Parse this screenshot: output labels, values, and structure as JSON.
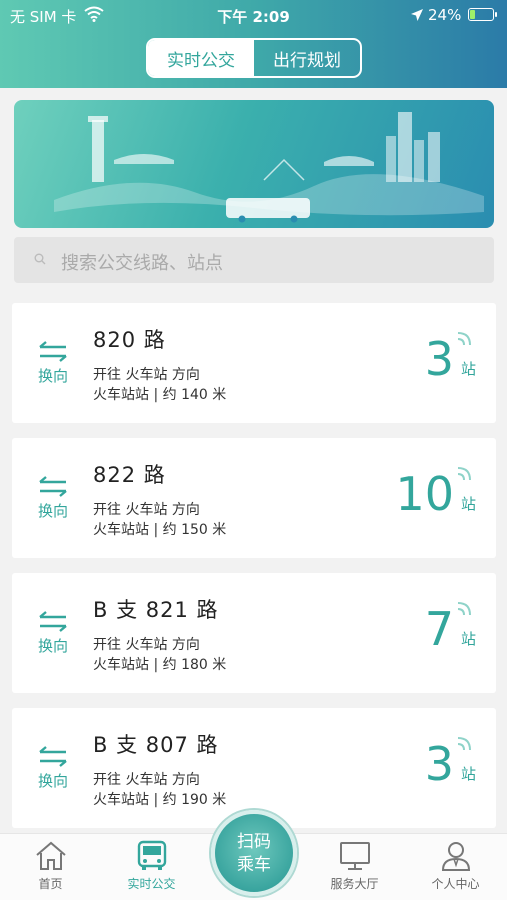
{
  "status_bar": {
    "carrier": "无 SIM 卡",
    "time": "下午 2:09",
    "battery": "24%",
    "battery_level": 0.24
  },
  "tabs": {
    "realtime": "实时公交",
    "planning": "出行规划"
  },
  "search": {
    "placeholder": "搜索公交线路、站点"
  },
  "routes": [
    {
      "name": "820 路",
      "swap_label": "换向",
      "direction": "开往 火车站 方向",
      "stop_distance": "火车站站 | 约 140 米",
      "stops": "3",
      "unit": "站"
    },
    {
      "name": "822 路",
      "swap_label": "换向",
      "direction": "开往 火车站 方向",
      "stop_distance": "火车站站 | 约 150 米",
      "stops": "10",
      "unit": "站"
    },
    {
      "name": "B 支 821 路",
      "swap_label": "换向",
      "direction": "开往 火车站 方向",
      "stop_distance": "火车站站 | 约 180 米",
      "stops": "7",
      "unit": "站"
    },
    {
      "name": "B 支 807 路",
      "swap_label": "换向",
      "direction": "开往 火车站 方向",
      "stop_distance": "火车站站 | 约 190 米",
      "stops": "3",
      "unit": "站"
    }
  ],
  "bottom_nav": {
    "home": "首页",
    "realtime": "实时公交",
    "scan_line1": "扫码",
    "scan_line2": "乘车",
    "service": "服务大厅",
    "profile": "个人中心"
  },
  "colors": {
    "accent": "#33a69c",
    "header_start": "#5fc9b3",
    "header_end": "#2b7ba8"
  }
}
